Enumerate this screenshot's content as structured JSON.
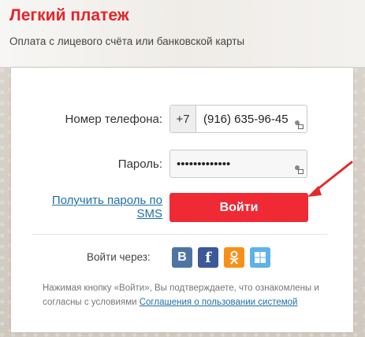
{
  "header": {
    "title": "Легкий платеж",
    "subtitle": "Оплата с лицевого счёта или банковской карты"
  },
  "form": {
    "phone_label": "Номер телефона:",
    "phone_prefix": "+7",
    "phone_value": "(916) 635-96-45",
    "password_label": "Пароль:",
    "password_value": "•••••••••••••",
    "sms_link": "Получить пароль по SMS",
    "login_button": "Войти"
  },
  "social": {
    "label": "Войти через:",
    "providers": [
      {
        "name": "vk-icon",
        "glyph": "B",
        "color": "#4d75a3"
      },
      {
        "name": "facebook-icon",
        "glyph": "f",
        "color": "#3b5998"
      },
      {
        "name": "odnoklassniki-icon",
        "glyph": "ok",
        "color": "#f79018"
      },
      {
        "name": "windows-icon",
        "glyph": "win",
        "color": "#5db2e8"
      }
    ]
  },
  "terms": {
    "text": "Нажимая кнопку «Войти», Вы подтверждаете, что ознакомлены и согласны с условиями",
    "link": "Соглашения о пользовании системой"
  },
  "colors": {
    "accent": "#ef2a35",
    "title": "#e8232a",
    "link": "#1f6fa8"
  }
}
